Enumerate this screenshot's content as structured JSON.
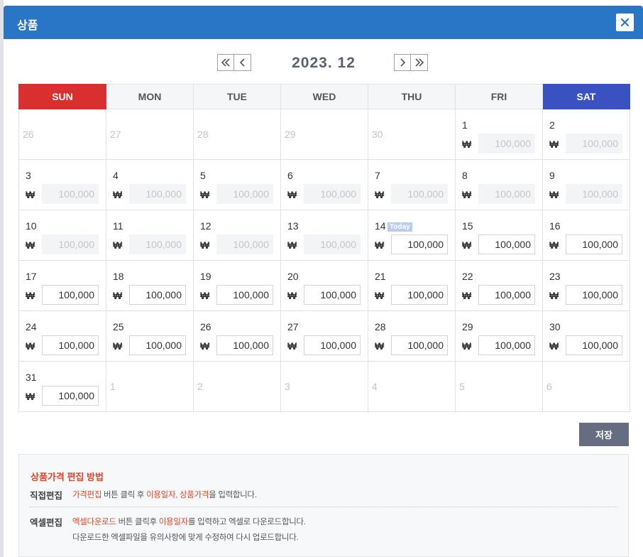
{
  "modal": {
    "title": "상품"
  },
  "calendar": {
    "month_label": "2023. 12",
    "weekdays": [
      "SUN",
      "MON",
      "TUE",
      "WED",
      "THU",
      "FRI",
      "SAT"
    ],
    "currency_symbol": "₩",
    "today_label": "Today",
    "weeks": [
      [
        {
          "day": "26",
          "other": true
        },
        {
          "day": "27",
          "other": true
        },
        {
          "day": "28",
          "other": true
        },
        {
          "day": "29",
          "other": true
        },
        {
          "day": "30",
          "other": true
        },
        {
          "day": "1",
          "price": "100,000",
          "disabled": true
        },
        {
          "day": "2",
          "price": "100,000",
          "disabled": true
        }
      ],
      [
        {
          "day": "3",
          "price": "100,000",
          "disabled": true
        },
        {
          "day": "4",
          "price": "100,000",
          "disabled": true
        },
        {
          "day": "5",
          "price": "100,000",
          "disabled": true
        },
        {
          "day": "6",
          "price": "100,000",
          "disabled": true
        },
        {
          "day": "7",
          "price": "100,000",
          "disabled": true
        },
        {
          "day": "8",
          "price": "100,000",
          "disabled": true
        },
        {
          "day": "9",
          "price": "100,000",
          "disabled": true
        }
      ],
      [
        {
          "day": "10",
          "price": "100,000",
          "disabled": true
        },
        {
          "day": "11",
          "price": "100,000",
          "disabled": true
        },
        {
          "day": "12",
          "price": "100,000",
          "disabled": true
        },
        {
          "day": "13",
          "price": "100,000",
          "disabled": true
        },
        {
          "day": "14",
          "price": "100,000",
          "today": true
        },
        {
          "day": "15",
          "price": "100,000"
        },
        {
          "day": "16",
          "price": "100,000"
        }
      ],
      [
        {
          "day": "17",
          "price": "100,000"
        },
        {
          "day": "18",
          "price": "100,000"
        },
        {
          "day": "19",
          "price": "100,000"
        },
        {
          "day": "20",
          "price": "100,000"
        },
        {
          "day": "21",
          "price": "100,000"
        },
        {
          "day": "22",
          "price": "100,000"
        },
        {
          "day": "23",
          "price": "100,000"
        }
      ],
      [
        {
          "day": "24",
          "price": "100,000"
        },
        {
          "day": "25",
          "price": "100,000"
        },
        {
          "day": "26",
          "price": "100,000"
        },
        {
          "day": "27",
          "price": "100,000"
        },
        {
          "day": "28",
          "price": "100,000"
        },
        {
          "day": "29",
          "price": "100,000"
        },
        {
          "day": "30",
          "price": "100,000"
        }
      ],
      [
        {
          "day": "31",
          "price": "100,000"
        },
        {
          "day": "1",
          "other": true
        },
        {
          "day": "2",
          "other": true
        },
        {
          "day": "3",
          "other": true
        },
        {
          "day": "4",
          "other": true
        },
        {
          "day": "5",
          "other": true
        },
        {
          "day": "6",
          "other": true
        }
      ]
    ]
  },
  "actions": {
    "save_label": "저장"
  },
  "help": {
    "title": "상품가격 편집 방법",
    "direct": {
      "label": "직접편집",
      "hl1": "가격편집",
      "t1": " 버튼 클릭 후 ",
      "hl2": "이용일자, 상품가격",
      "t2": "을 입력합니다."
    },
    "excel": {
      "label": "엑셀편집",
      "hl1": "엑셀다운로드",
      "t1": " 버튼 클릭후 ",
      "hl2": "이용일자",
      "t2": "를 입력하고 엑셀로 다운로드합니다.",
      "line2": "다운로드한 엑셀파일을 유의사항에 맞게 수정하여 다시 업로드합니다."
    }
  },
  "colors": {
    "header": "#2a76c6",
    "sunday": "#d9302f",
    "saturday": "#3a52c0",
    "highlight": "#e2452a",
    "save": "#676d80"
  }
}
